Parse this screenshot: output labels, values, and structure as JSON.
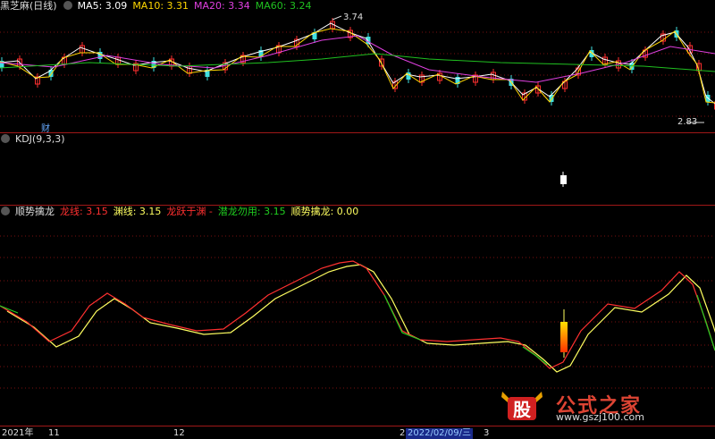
{
  "main": {
    "stock": "黑芝麻(日线)",
    "ma": [
      {
        "label": "MA5: 3.09",
        "color": "#ffffff"
      },
      {
        "label": "MA10: 3.31",
        "color": "#ffd700"
      },
      {
        "label": "MA20: 3.34",
        "color": "#e040e0"
      },
      {
        "label": "MA60: 3.24",
        "color": "#20c020"
      }
    ],
    "high_label": "3.74",
    "low_label": "2.83",
    "marker": "财"
  },
  "kdj": {
    "title": "KDJ(9,3,3)"
  },
  "indicator": {
    "title": "顺势擒龙",
    "items": [
      {
        "label": "龙线: 3.15",
        "color": "#ff3030"
      },
      {
        "label": "渊线: 3.15",
        "color": "#ffff60"
      },
      {
        "label": "龙跃于渊 -",
        "color": "#ff3030"
      },
      {
        "label": "潜龙勿用: 3.15",
        "color": "#20d020"
      },
      {
        "label": "顺势擒龙: 0.00",
        "color": "#ffff60"
      }
    ]
  },
  "time_axis": {
    "labels": [
      "2021年",
      "11",
      "12",
      "2",
      "2022/02/09/三",
      "3"
    ]
  },
  "watermark": {
    "text": "公式之家",
    "url": "www.gszj100.com",
    "logo": "股"
  }
}
